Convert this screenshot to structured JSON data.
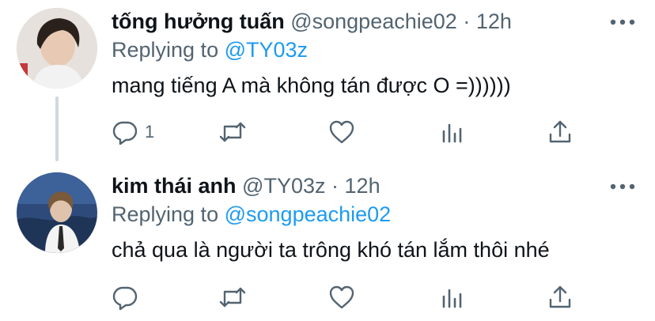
{
  "tweets": [
    {
      "name": "tống hưởng tuấn",
      "handle": "@songpeachie02",
      "separator": "·",
      "time": "12h",
      "replying_prefix": "Replying to",
      "replying_to": "@TY03z",
      "text": "mang tiếng A mà không tán được O =))))))",
      "reply_count": "1"
    },
    {
      "name": "kim thái anh",
      "handle": "@TY03z",
      "separator": "·",
      "time": "12h",
      "replying_prefix": "Replying to",
      "replying_to": "@songpeachie02",
      "text": "chả qua là người ta trông khó tán lắm thôi nhé",
      "reply_count": ""
    }
  ],
  "icons": [
    "reply-icon",
    "retweet-icon",
    "like-icon",
    "analytics-icon",
    "share-icon",
    "more-icon"
  ],
  "colors": {
    "text": "#0f1419",
    "secondary": "#536471",
    "link": "#1d9bf0",
    "thread_line": "#cfd9de"
  }
}
